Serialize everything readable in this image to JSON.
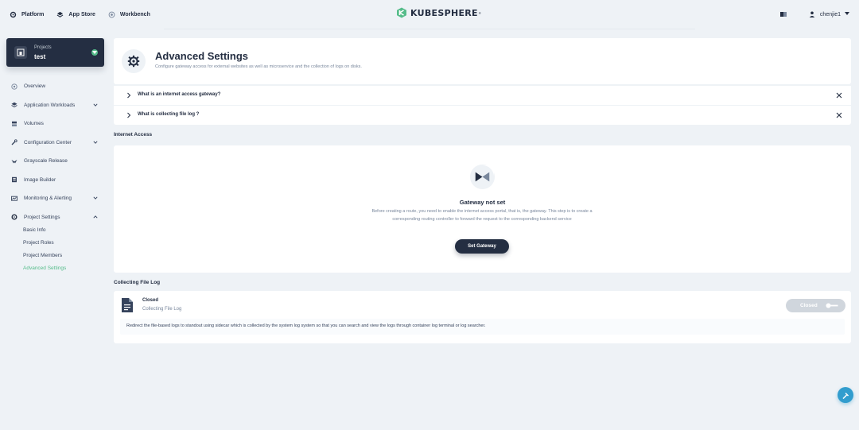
{
  "topbar": {
    "nav": [
      {
        "label": "Platform",
        "icon": "gear-icon"
      },
      {
        "label": "App Store",
        "icon": "box-icon"
      },
      {
        "label": "Workbench",
        "icon": "target-icon"
      }
    ],
    "logo_text": "KUBESPHERE",
    "logo_tm": "®",
    "user": "chenjie1"
  },
  "project": {
    "label": "Projects",
    "name": "test"
  },
  "menu": [
    {
      "label": "Overview",
      "icon": "overview-icon",
      "expandable": false
    },
    {
      "label": "Application Workloads",
      "icon": "appstack-icon",
      "expandable": true
    },
    {
      "label": "Volumes",
      "icon": "storage-icon",
      "expandable": false
    },
    {
      "label": "Configuration Center",
      "icon": "wrench-icon",
      "expandable": true
    },
    {
      "label": "Grayscale Release",
      "icon": "bird-icon",
      "expandable": false
    },
    {
      "label": "Image Builder",
      "icon": "image-builder-icon",
      "expandable": false
    },
    {
      "label": "Monitoring & Alerting",
      "icon": "monitor-icon",
      "expandable": true
    },
    {
      "label": "Project Settings",
      "icon": "settings-icon",
      "expandable": true
    }
  ],
  "submenu": [
    {
      "label": "Basic Info"
    },
    {
      "label": "Project Roles"
    },
    {
      "label": "Project Members"
    },
    {
      "label": "Advanced Settings"
    }
  ],
  "header": {
    "title": "Advanced Settings",
    "description": "Configure gateway access for external websites as well as microservice and the collection of logs on disks."
  },
  "faq": [
    {
      "question": "What is an internet access gateway?"
    },
    {
      "question": "What is collecting file log ?"
    }
  ],
  "internet_access": {
    "section_title": "Internet Access",
    "empty_title": "Gateway not set",
    "empty_description": "Before creating a route, you need to enable the internet access portal, that is, the gateway. This step is to create a corresponding routing controller to forward the request to the corresponding backend service",
    "button_label": "Set Gateway"
  },
  "file_log": {
    "section_title": "Collecting File Log",
    "state": "Closed",
    "name": "Collecting File Log",
    "toggle_label": "Closed",
    "description": "Redirect the file-based logs to standout using sidecar which is collected by the system log system so that you can search and view the logs through container log terminal or log searcher."
  },
  "colors": {
    "accent_green": "#55bc8a",
    "dark": "#242e42",
    "fab_blue": "#329dce"
  }
}
